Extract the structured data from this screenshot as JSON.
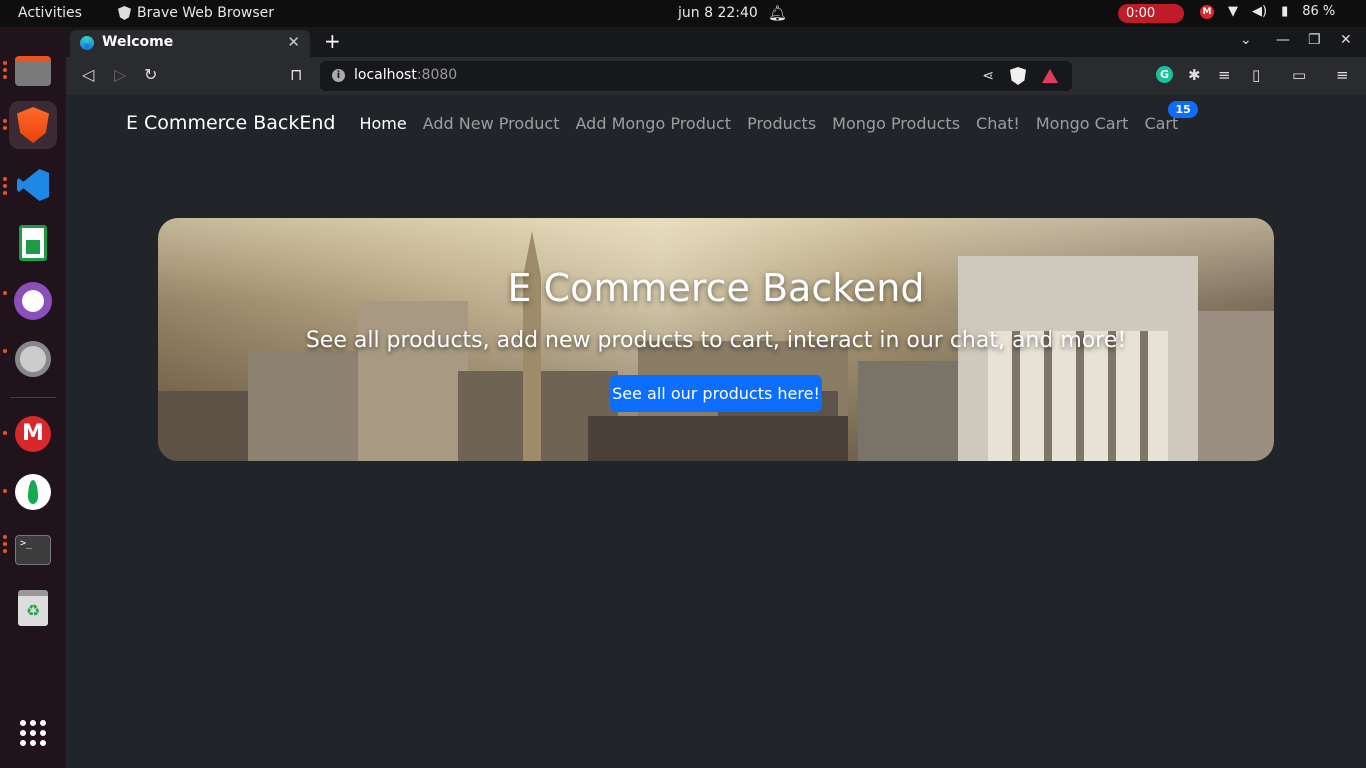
{
  "topbar": {
    "activities": "Activities",
    "app_name": "Brave Web Browser",
    "clock": "jun 8  22:40",
    "recording_time": "0:00",
    "battery": "86 %"
  },
  "dock": {
    "apps": [
      "files",
      "brave-browser",
      "vscode",
      "libreoffice-calc",
      "github-desktop",
      "settings",
      "mega",
      "mongodb-compass",
      "terminal",
      "trash",
      "show-apps"
    ]
  },
  "browser": {
    "tab_title": "Welcome",
    "url_host": "localhost",
    "url_port": ":8080"
  },
  "site": {
    "brand": "E Commerce BackEnd",
    "nav": [
      "Home",
      "Add New Product",
      "Add Mongo Product",
      "Products",
      "Mongo Products",
      "Chat!",
      "Mongo Cart",
      "Cart"
    ],
    "cart_count": "15",
    "hero_title": "E Commerce Backend",
    "hero_subtitle": "See all products, add new products to cart, interact in our chat, and more!",
    "hero_button": "See all our products here!"
  },
  "colors": {
    "page_bg": "#212529",
    "primary": "#0d6efd",
    "dock_bg": "#21131c",
    "accent_dots": "#e95420"
  }
}
